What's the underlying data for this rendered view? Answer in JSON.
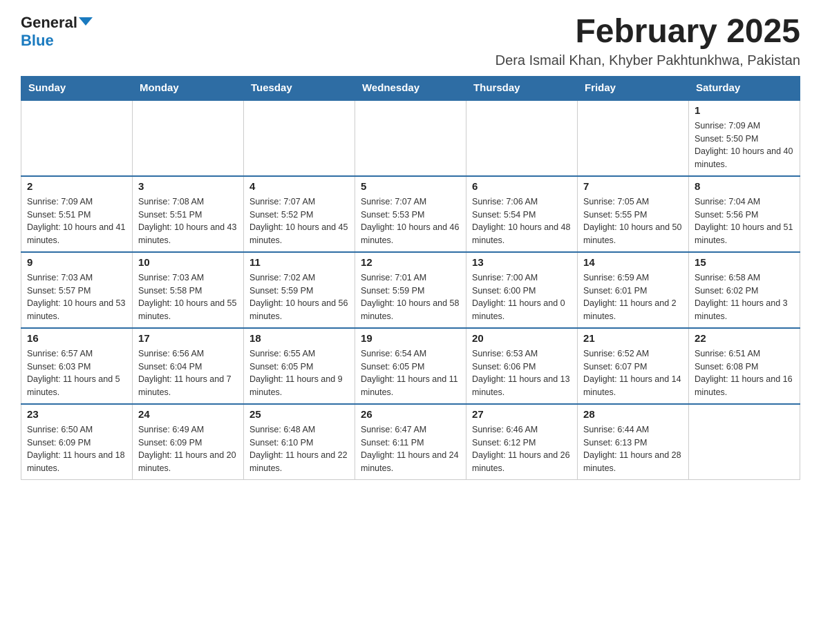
{
  "logo": {
    "general": "General",
    "blue": "Blue"
  },
  "title": "February 2025",
  "subtitle": "Dera Ismail Khan, Khyber Pakhtunkhwa, Pakistan",
  "headers": [
    "Sunday",
    "Monday",
    "Tuesday",
    "Wednesday",
    "Thursday",
    "Friday",
    "Saturday"
  ],
  "weeks": [
    [
      {
        "day": "",
        "info": ""
      },
      {
        "day": "",
        "info": ""
      },
      {
        "day": "",
        "info": ""
      },
      {
        "day": "",
        "info": ""
      },
      {
        "day": "",
        "info": ""
      },
      {
        "day": "",
        "info": ""
      },
      {
        "day": "1",
        "info": "Sunrise: 7:09 AM\nSunset: 5:50 PM\nDaylight: 10 hours and 40 minutes."
      }
    ],
    [
      {
        "day": "2",
        "info": "Sunrise: 7:09 AM\nSunset: 5:51 PM\nDaylight: 10 hours and 41 minutes."
      },
      {
        "day": "3",
        "info": "Sunrise: 7:08 AM\nSunset: 5:51 PM\nDaylight: 10 hours and 43 minutes."
      },
      {
        "day": "4",
        "info": "Sunrise: 7:07 AM\nSunset: 5:52 PM\nDaylight: 10 hours and 45 minutes."
      },
      {
        "day": "5",
        "info": "Sunrise: 7:07 AM\nSunset: 5:53 PM\nDaylight: 10 hours and 46 minutes."
      },
      {
        "day": "6",
        "info": "Sunrise: 7:06 AM\nSunset: 5:54 PM\nDaylight: 10 hours and 48 minutes."
      },
      {
        "day": "7",
        "info": "Sunrise: 7:05 AM\nSunset: 5:55 PM\nDaylight: 10 hours and 50 minutes."
      },
      {
        "day": "8",
        "info": "Sunrise: 7:04 AM\nSunset: 5:56 PM\nDaylight: 10 hours and 51 minutes."
      }
    ],
    [
      {
        "day": "9",
        "info": "Sunrise: 7:03 AM\nSunset: 5:57 PM\nDaylight: 10 hours and 53 minutes."
      },
      {
        "day": "10",
        "info": "Sunrise: 7:03 AM\nSunset: 5:58 PM\nDaylight: 10 hours and 55 minutes."
      },
      {
        "day": "11",
        "info": "Sunrise: 7:02 AM\nSunset: 5:59 PM\nDaylight: 10 hours and 56 minutes."
      },
      {
        "day": "12",
        "info": "Sunrise: 7:01 AM\nSunset: 5:59 PM\nDaylight: 10 hours and 58 minutes."
      },
      {
        "day": "13",
        "info": "Sunrise: 7:00 AM\nSunset: 6:00 PM\nDaylight: 11 hours and 0 minutes."
      },
      {
        "day": "14",
        "info": "Sunrise: 6:59 AM\nSunset: 6:01 PM\nDaylight: 11 hours and 2 minutes."
      },
      {
        "day": "15",
        "info": "Sunrise: 6:58 AM\nSunset: 6:02 PM\nDaylight: 11 hours and 3 minutes."
      }
    ],
    [
      {
        "day": "16",
        "info": "Sunrise: 6:57 AM\nSunset: 6:03 PM\nDaylight: 11 hours and 5 minutes."
      },
      {
        "day": "17",
        "info": "Sunrise: 6:56 AM\nSunset: 6:04 PM\nDaylight: 11 hours and 7 minutes."
      },
      {
        "day": "18",
        "info": "Sunrise: 6:55 AM\nSunset: 6:05 PM\nDaylight: 11 hours and 9 minutes."
      },
      {
        "day": "19",
        "info": "Sunrise: 6:54 AM\nSunset: 6:05 PM\nDaylight: 11 hours and 11 minutes."
      },
      {
        "day": "20",
        "info": "Sunrise: 6:53 AM\nSunset: 6:06 PM\nDaylight: 11 hours and 13 minutes."
      },
      {
        "day": "21",
        "info": "Sunrise: 6:52 AM\nSunset: 6:07 PM\nDaylight: 11 hours and 14 minutes."
      },
      {
        "day": "22",
        "info": "Sunrise: 6:51 AM\nSunset: 6:08 PM\nDaylight: 11 hours and 16 minutes."
      }
    ],
    [
      {
        "day": "23",
        "info": "Sunrise: 6:50 AM\nSunset: 6:09 PM\nDaylight: 11 hours and 18 minutes."
      },
      {
        "day": "24",
        "info": "Sunrise: 6:49 AM\nSunset: 6:09 PM\nDaylight: 11 hours and 20 minutes."
      },
      {
        "day": "25",
        "info": "Sunrise: 6:48 AM\nSunset: 6:10 PM\nDaylight: 11 hours and 22 minutes."
      },
      {
        "day": "26",
        "info": "Sunrise: 6:47 AM\nSunset: 6:11 PM\nDaylight: 11 hours and 24 minutes."
      },
      {
        "day": "27",
        "info": "Sunrise: 6:46 AM\nSunset: 6:12 PM\nDaylight: 11 hours and 26 minutes."
      },
      {
        "day": "28",
        "info": "Sunrise: 6:44 AM\nSunset: 6:13 PM\nDaylight: 11 hours and 28 minutes."
      },
      {
        "day": "",
        "info": ""
      }
    ]
  ]
}
